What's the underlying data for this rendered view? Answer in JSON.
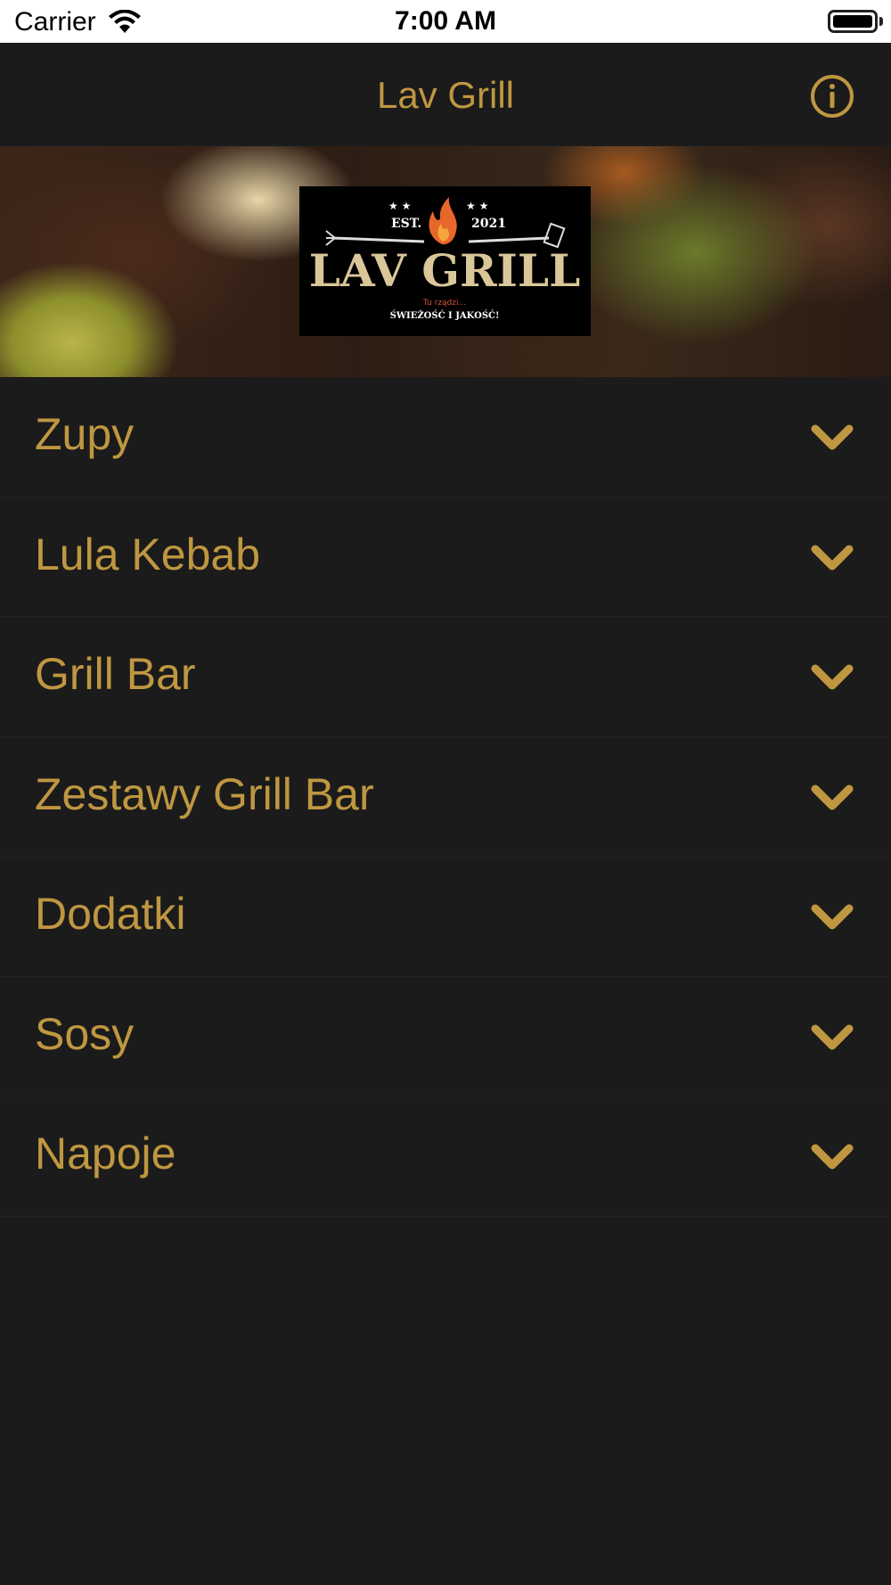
{
  "status_bar": {
    "carrier": "Carrier",
    "time": "7:00 AM"
  },
  "nav_bar": {
    "title": "Lav Grill",
    "info_icon": "info-icon"
  },
  "hero": {
    "logo": {
      "established_label": "EST.",
      "year": "2021",
      "brand": "LAV GRILL",
      "tagline_small": "Tu rządzi...",
      "tagline": "ŚWIEŻOŚĆ I JAKOŚĆ!"
    }
  },
  "menu": {
    "items": [
      {
        "label": "Zupy"
      },
      {
        "label": "Lula Kebab"
      },
      {
        "label": "Grill Bar"
      },
      {
        "label": "Zestawy Grill Bar"
      },
      {
        "label": "Dodatki"
      },
      {
        "label": "Sosy"
      },
      {
        "label": "Napoje"
      }
    ],
    "chevron_icon": "chevron-down-icon"
  },
  "colors": {
    "accent": "#bf9741",
    "background": "#1b1b1b",
    "status_bar": "#ffffff"
  }
}
